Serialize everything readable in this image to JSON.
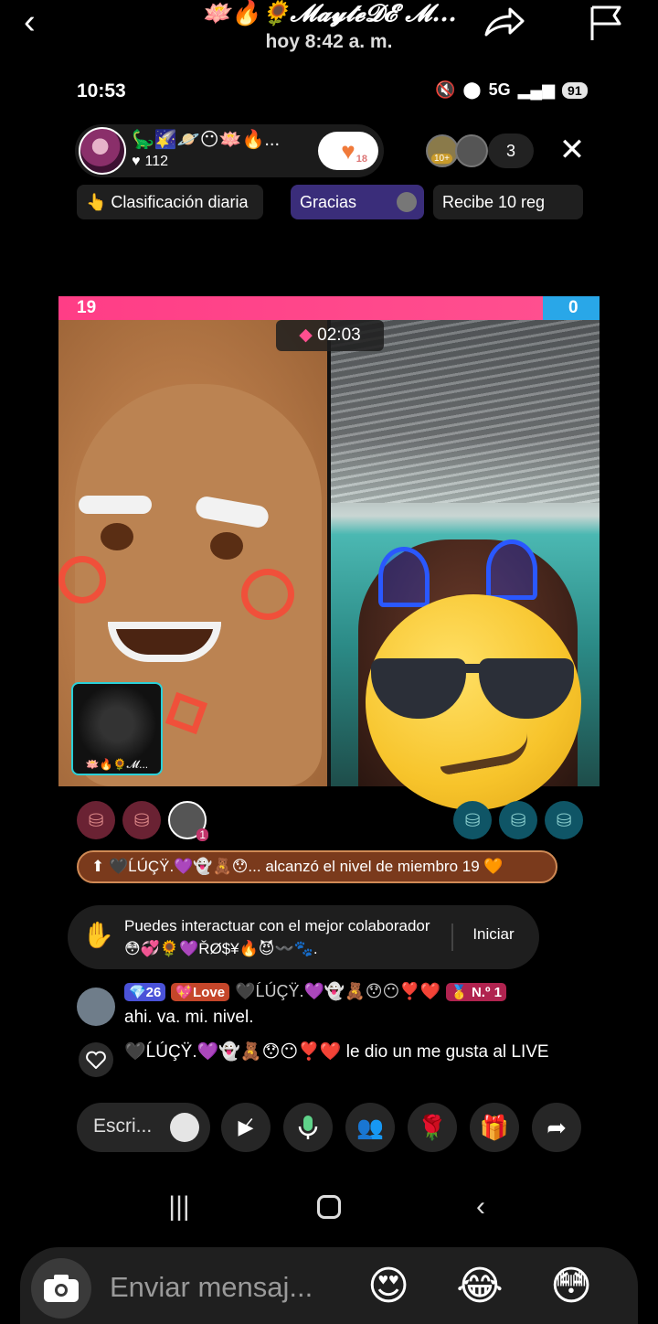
{
  "story": {
    "author": "🪷🔥🌻𝓜𝓪𝔂𝓽𝓮𝓓𝓔 𝓜...",
    "time": "hoy 8:42 a. m."
  },
  "status_bar": {
    "time": "10:53",
    "network": "5G",
    "battery": "91"
  },
  "host": {
    "name": "🦕🌠🪐😶🪷🔥...",
    "likes": "112",
    "follow_count": "18"
  },
  "viewers": {
    "count": "3",
    "badge": "10+"
  },
  "chips": {
    "ranking": "👆 Clasificación diaria",
    "thanks": "Gracias",
    "gifts": "Recibe 10 reg"
  },
  "battle": {
    "score_left": "19",
    "score_right": "0",
    "timer": "02:03",
    "left_fraction": 1.0,
    "mini_cam_label": "🪷🔥🌻𝓜..."
  },
  "seats": {
    "left_badge": "1"
  },
  "level_banner": "⬆ 🖤ĹÚÇŸ.💜👻🧸😯... alcanzó el nivel de miembro 19 🧡",
  "interact": {
    "text": "Puedes interactuar con el mejor colaborador 😳💞🌻💜ŘØ$¥🔥😈〰️🐾.",
    "button": "Iniciar"
  },
  "comment": {
    "level": "💎26",
    "love_badge": "💖Love",
    "user": "🖤ĹÚÇŸ.💜👻🧸😯😶❣️❤️",
    "rank": "🥇 N.º 1",
    "text": "ahi. va. mi. nivel."
  },
  "like_event": "🖤ĹÚÇŸ.💜👻🧸😯😶❣️❤️ le dio un me gusta al LIVE",
  "toolbar": {
    "input_placeholder": "Escri..."
  },
  "reply": {
    "placeholder": "Enviar mensaj...",
    "reactions": [
      "😍",
      "😂",
      "😳"
    ]
  },
  "colors": {
    "pink": "#ff3d86",
    "blue": "#29a7e8",
    "chip_purple": "#3a2d7a"
  }
}
